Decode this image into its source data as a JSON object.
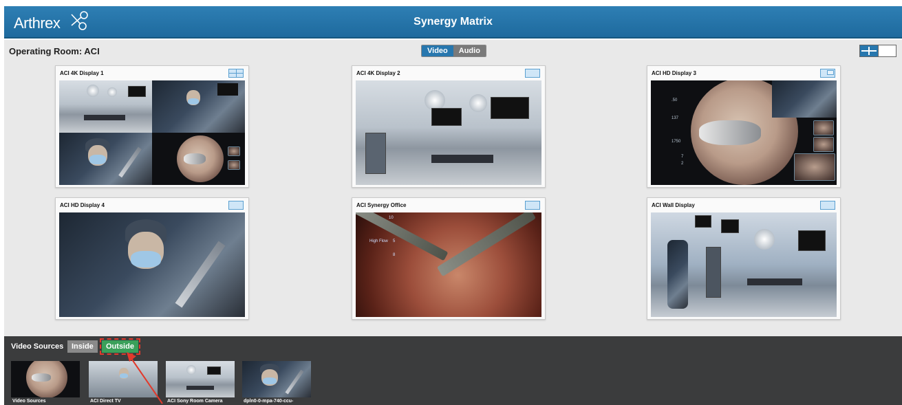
{
  "header": {
    "logo_text": "Arthrex",
    "title": "Synergy Matrix",
    "background": "#2677ad"
  },
  "room": {
    "title": "Operating Room: ACI"
  },
  "mode_toggle": {
    "video_label": "Video",
    "audio_label": "Audio",
    "selected": "Video"
  },
  "layout_toggle": {
    "options": [
      "grid-icon",
      "single-icon"
    ],
    "selected": "grid-icon"
  },
  "displays": [
    {
      "name": "ACI 4K Display 1",
      "layout_icon": "quad-layout-icon",
      "content": "quad view"
    },
    {
      "name": "ACI 4K Display 2",
      "layout_icon": "single-layout-icon",
      "content": "operating room"
    },
    {
      "name": "ACI HD Display 3",
      "layout_icon": "pip-layout-icon",
      "content": "endoscope view"
    },
    {
      "name": "ACI HD Display 4",
      "layout_icon": "single-layout-icon",
      "content": "surgeon"
    },
    {
      "name": "ACI Synergy Office",
      "layout_icon": "single-layout-icon",
      "content": "laparoscopic view"
    },
    {
      "name": "ACI Wall Display",
      "layout_icon": "single-layout-icon",
      "content": "operating room"
    }
  ],
  "endo_overlay": {
    "value_a": ".50",
    "value_b": "137",
    "value_c": "1750",
    "pump_a": "7",
    "pump_b": "2"
  },
  "lap_overlay": {
    "value_top": "10",
    "value_mid": "5",
    "value_low": "8",
    "label_high_flow": "High Flow"
  },
  "sources": {
    "title": "Video Sources",
    "tabs": {
      "inside": "Inside",
      "outside": "Outside"
    },
    "selected_tab": "Outside",
    "items": [
      {
        "label": "Video Sources"
      },
      {
        "label": "ACI Direct TV"
      },
      {
        "label": "ACI Sony Room Camera"
      },
      {
        "label": "dpln0-0-mpa-740-ccu-"
      }
    ]
  },
  "colors": {
    "accent": "#2777ae",
    "outside_tab": "#3aa05a",
    "highlight": "#e23a2c"
  }
}
